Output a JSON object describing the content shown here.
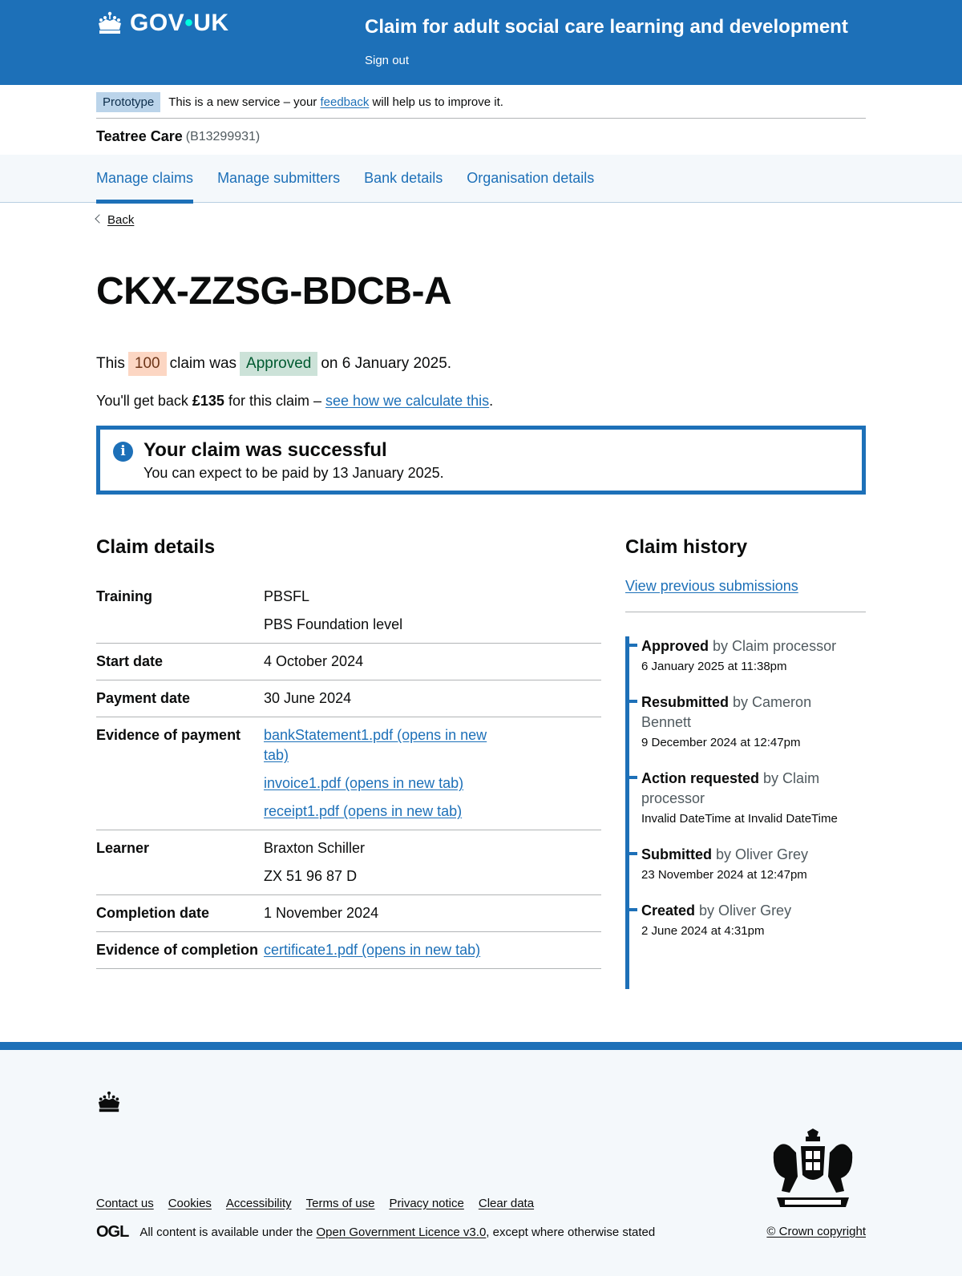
{
  "header": {
    "logo_text_gov": "GOV",
    "logo_text_uk": "UK",
    "service_name": "Claim for adult social care learning and development",
    "sign_out": "Sign out"
  },
  "phase_banner": {
    "tag": "Prototype",
    "text_before": "This is a new service – your",
    "link": "feedback",
    "text_after": "will help us to improve it."
  },
  "organisation": {
    "name": "Teatree Care",
    "reference": "(B13299931)"
  },
  "nav": {
    "items": [
      {
        "label": "Manage claims",
        "active": true
      },
      {
        "label": "Manage submitters"
      },
      {
        "label": "Bank details"
      },
      {
        "label": "Organisation details"
      }
    ]
  },
  "back_link": "Back",
  "claim": {
    "reference": "CKX-ZZSG-BDCB-A",
    "status_prefix": "This",
    "claim_type": "100",
    "status_middle": "claim was",
    "status": "Approved",
    "status_suffix": "on 6 January 2025.",
    "payback_prefix": "You'll get back",
    "payback_amount": "£135",
    "payback_middle": "for this claim –",
    "payback_link": "see how we calculate this",
    "payback_suffix": "."
  },
  "notice": {
    "icon": "info-icon",
    "title": "Your claim was successful",
    "text": "You can expect to be paid by 13 January 2025."
  },
  "details": {
    "title": "Claim details",
    "rows": [
      {
        "key": "Training",
        "values": [
          "PBSFL",
          "PBS Foundation level"
        ]
      },
      {
        "key": "Start date",
        "values": [
          "4 October 2024"
        ]
      },
      {
        "key": "Payment date",
        "values": [
          "30 June 2024"
        ]
      },
      {
        "key": "Evidence of payment",
        "links": [
          "bankStatement1.pdf (opens in new tab)",
          "invoice1.pdf (opens in new tab)",
          "receipt1.pdf (opens in new tab)"
        ]
      },
      {
        "key": "Learner",
        "values": [
          "Braxton Schiller",
          "ZX 51 96 87 D"
        ]
      },
      {
        "key": "Completion date",
        "values": [
          "1 November 2024"
        ]
      },
      {
        "key": "Evidence of completion",
        "links": [
          "certificate1.pdf (opens in new tab)"
        ]
      }
    ]
  },
  "history": {
    "title": "Claim history",
    "view_previous": "View previous submissions",
    "events": [
      {
        "action": "Approved",
        "by": "by Claim processor",
        "when": "6 January 2025 at 11:38pm"
      },
      {
        "action": "Resubmitted",
        "by": "by Cameron Bennett",
        "when": "9 December 2024 at 12:47pm"
      },
      {
        "action": "Action requested",
        "by": "by Claim processor",
        "when": "Invalid DateTime at Invalid DateTime"
      },
      {
        "action": "Submitted",
        "by": "by Oliver Grey",
        "when": "23 November 2024 at 12:47pm"
      },
      {
        "action": "Created",
        "by": "by Oliver Grey",
        "when": "2 June 2024 at 4:31pm"
      }
    ]
  },
  "footer": {
    "links": [
      "Contact us",
      "Cookies",
      "Accessibility",
      "Terms of use",
      "Privacy notice",
      "Clear data"
    ],
    "ogl_logo": "OGL",
    "licence_prefix": "All content is available under the",
    "licence_link": "Open Government Licence v3.0",
    "licence_suffix": ", except where otherwise stated",
    "copyright": "© Crown copyright"
  },
  "colors": {
    "brand_blue": "#1d70b8",
    "tag_orange_bg": "#fcd6c3",
    "tag_green_bg": "#cce2d8",
    "prototype_tag_bg": "#bbd4ea"
  }
}
